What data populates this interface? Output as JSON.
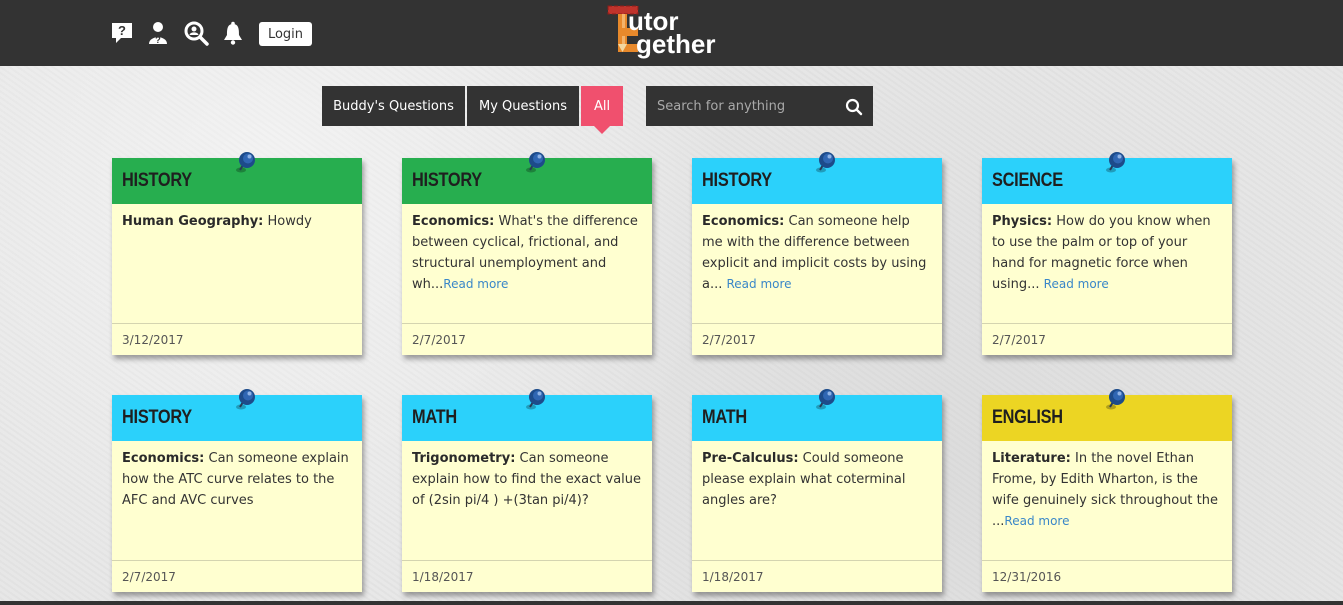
{
  "header": {
    "login_label": "Login",
    "logo_top": "utor",
    "logo_bottom": "gether",
    "icons": [
      "help-question-icon",
      "tutor-profile-icon",
      "find-tutor-icon",
      "notification-bell-icon"
    ]
  },
  "tabs": [
    {
      "label": "Buddy's Questions",
      "active": false
    },
    {
      "label": "My Questions",
      "active": false
    },
    {
      "label": "All",
      "active": true
    }
  ],
  "search": {
    "placeholder": "Search for anything"
  },
  "colors": {
    "green": "#27ae4f",
    "blue": "#2bd1fb",
    "yellow": "#ecd523",
    "pink": "#f0506e",
    "note": "#ffffd0"
  },
  "cards": [
    {
      "subject": "HISTORY",
      "color": "green",
      "category": "Human Geography:",
      "text": " Howdy",
      "more": "",
      "date": "3/12/2017"
    },
    {
      "subject": "HISTORY",
      "color": "green",
      "category": "Economics:",
      "text": " What's the difference between cyclical, frictional, and structural unemployment and wh...",
      "more": "Read more",
      "date": "2/7/2017"
    },
    {
      "subject": "HISTORY",
      "color": "blue",
      "category": "Economics:",
      "text": " Can someone help me with the difference between explicit and implicit costs by using a... ",
      "more": "Read more",
      "date": "2/7/2017"
    },
    {
      "subject": "SCIENCE",
      "color": "blue",
      "category": "Physics:",
      "text": " How do you know when to use the palm or top of your hand for magnetic force when using... ",
      "more": "Read more",
      "date": "2/7/2017"
    },
    {
      "subject": "HISTORY",
      "color": "blue",
      "category": "Economics:",
      "text": " Can someone explain how the ATC curve relates to the AFC and AVC curves",
      "more": "",
      "date": "2/7/2017"
    },
    {
      "subject": "MATH",
      "color": "blue",
      "category": "Trigonometry:",
      "text": " Can someone explain how to find the exact value of (2sin pi/4 ) +(3tan pi/4)?",
      "more": "",
      "date": "1/18/2017"
    },
    {
      "subject": "MATH",
      "color": "blue",
      "category": "Pre-Calculus:",
      "text": " Could someone please explain what coterminal angles are?",
      "more": "",
      "date": "1/18/2017"
    },
    {
      "subject": "ENGLISH",
      "color": "yellow",
      "category": "Literature:",
      "text": " In the novel Ethan Frome, by Edith Wharton, is the wife genuinely sick throughout the ...",
      "more": "Read more",
      "date": "12/31/2016"
    }
  ]
}
